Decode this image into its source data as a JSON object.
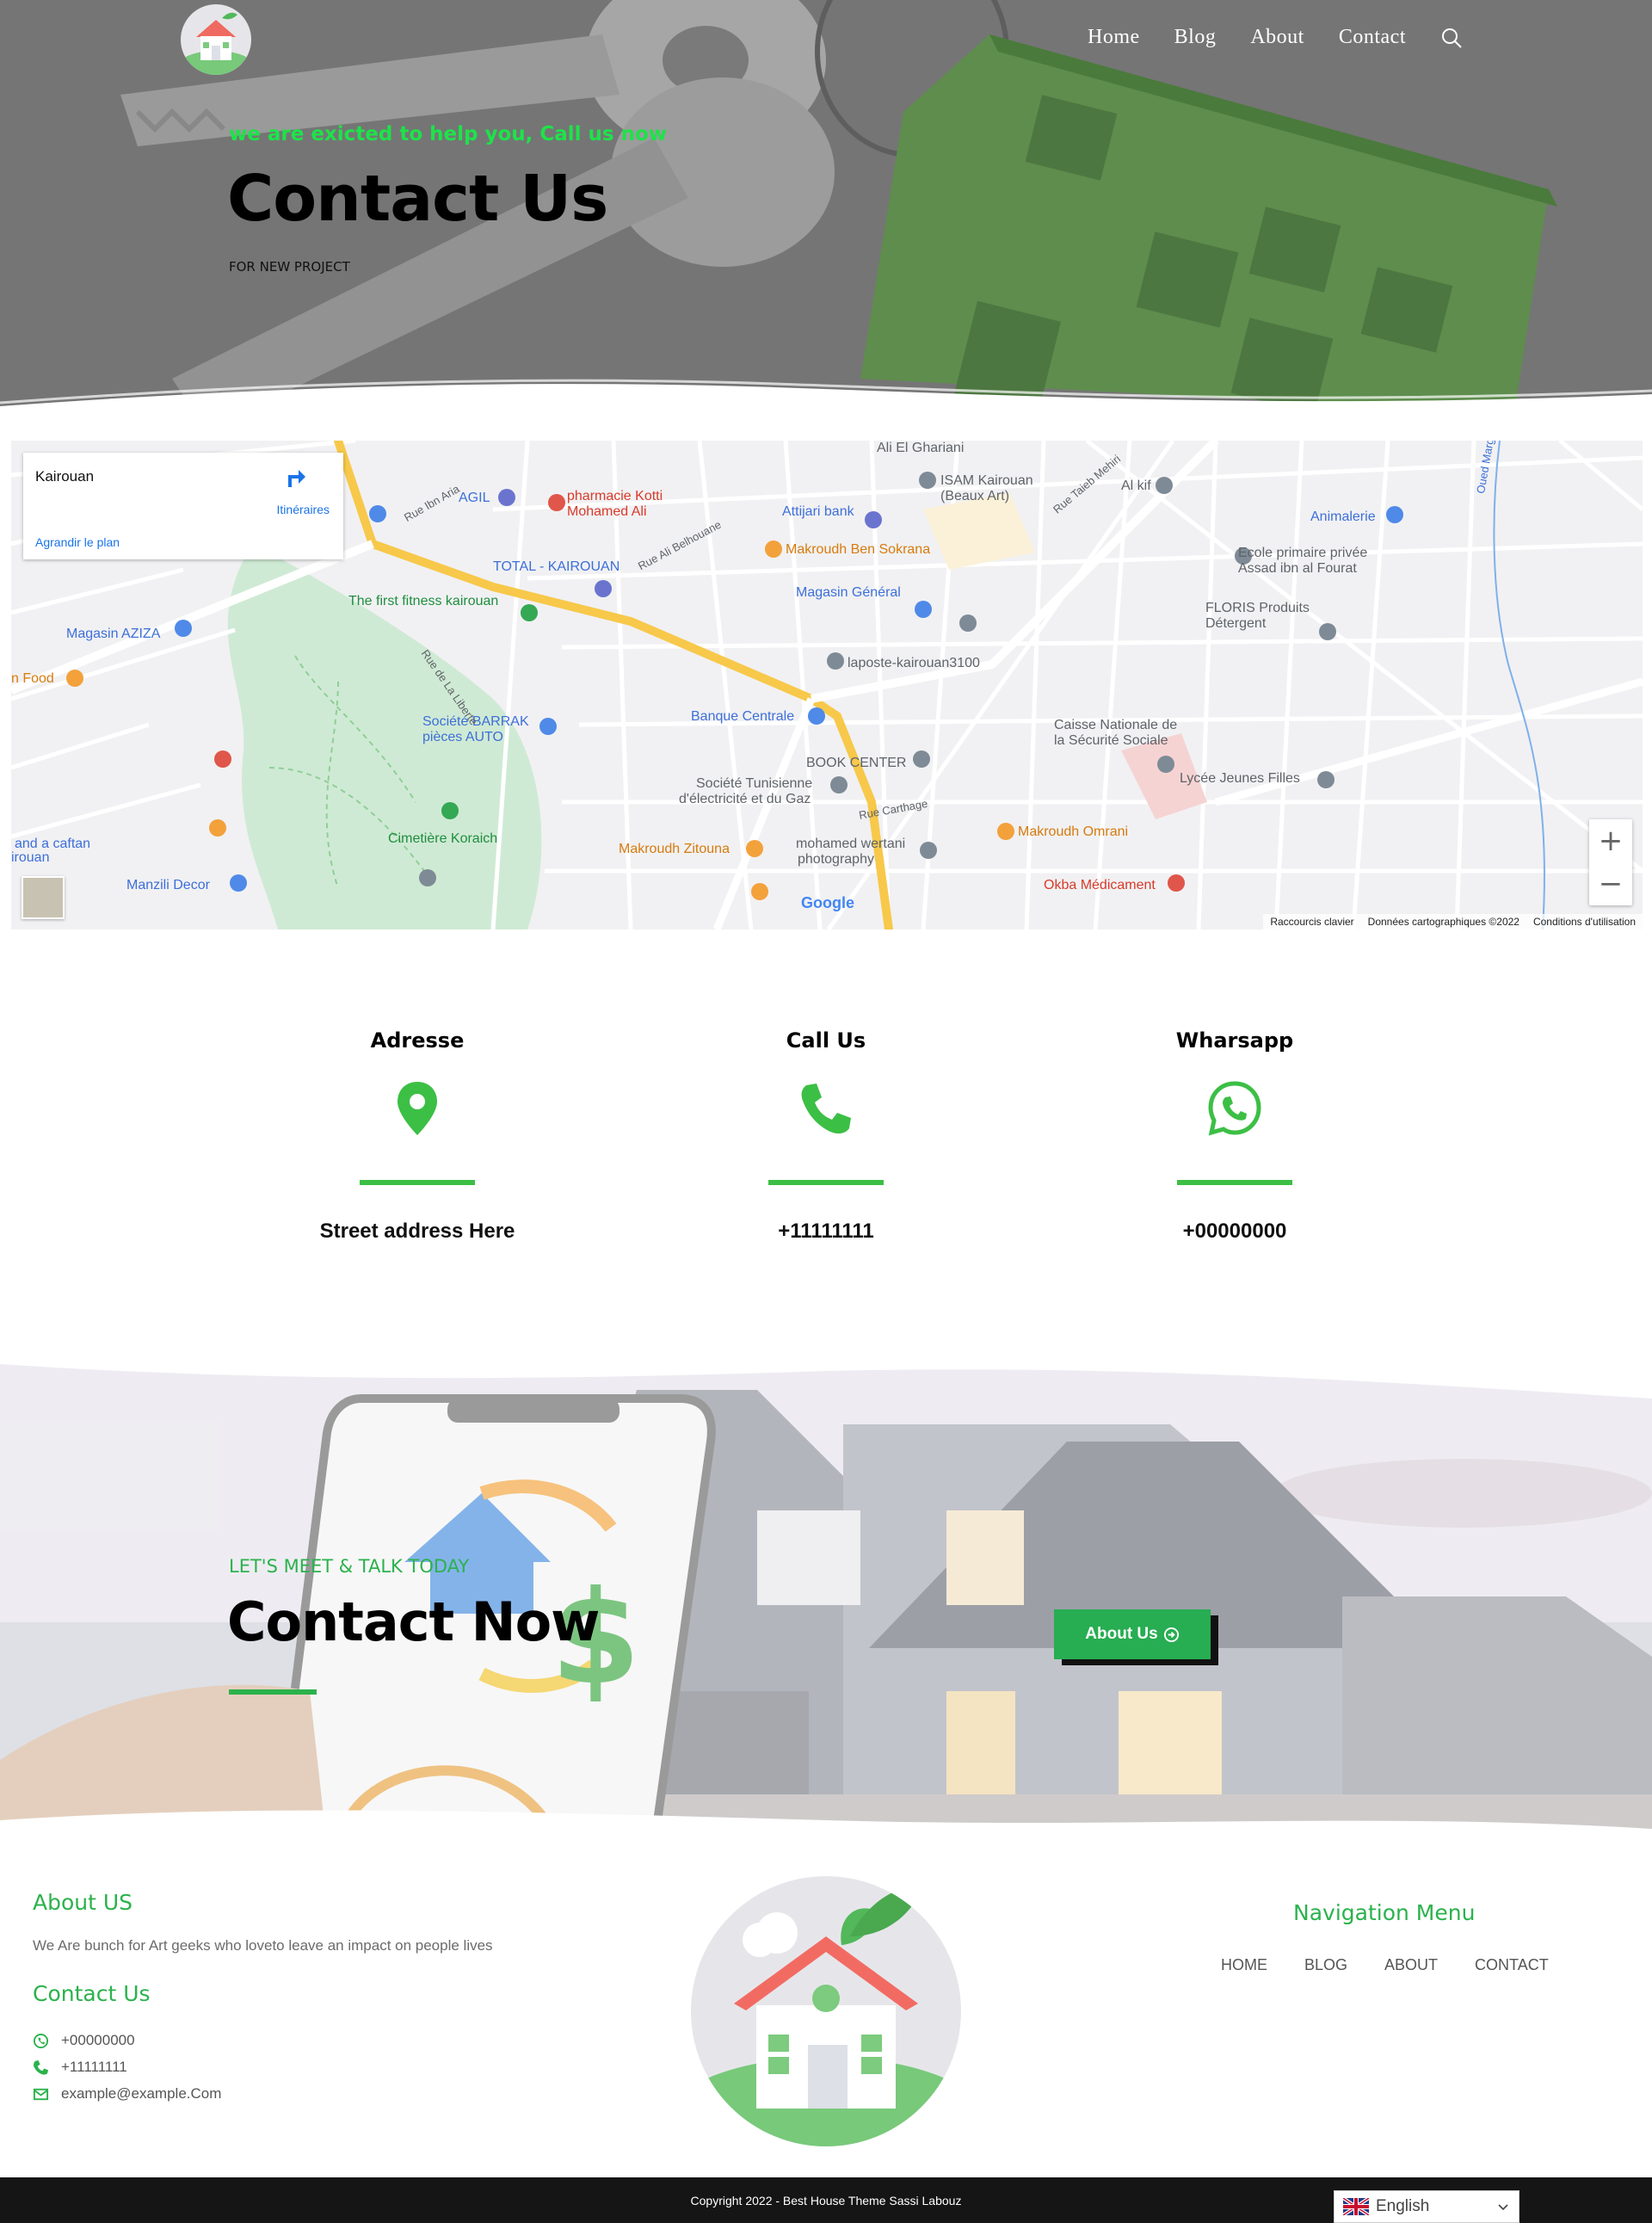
{
  "nav": {
    "items": [
      {
        "label": "Home"
      },
      {
        "label": "Blog"
      },
      {
        "label": "About"
      },
      {
        "label": "Contact"
      }
    ],
    "search_icon": "search-icon"
  },
  "hero": {
    "kicker": "we are exicted to help you, Call us now",
    "title": "Contact Us",
    "subtitle": "FOR NEW PROJECT"
  },
  "map": {
    "place_name": "Kairouan",
    "directions_label": "Itinéraires",
    "enlarge_label": "Agrandir le plan",
    "labels": [
      {
        "text": "Ali El Ghariani",
        "cls": "lbl-grey"
      },
      {
        "text": "ISAM Kairouan",
        "cls": "lbl-grey"
      },
      {
        "text": "(Beaux Art)",
        "cls": "lbl-grey"
      },
      {
        "text": "Al kif",
        "cls": "lbl-grey"
      },
      {
        "text": "AGIL",
        "cls": "lbl-blue"
      },
      {
        "text": "pharmacie Kotti",
        "cls": "lbl-red"
      },
      {
        "text": "Mohamed Ali",
        "cls": "lbl-red"
      },
      {
        "text": "Attijari bank",
        "cls": "lbl-blue"
      },
      {
        "text": "Makroudh Ben Sokrana",
        "cls": "lbl-orange"
      },
      {
        "text": "Animalerie",
        "cls": "lbl-blue"
      },
      {
        "text": "Ecole primaire privée",
        "cls": "lbl-grey"
      },
      {
        "text": "Assad ibn al Fourat",
        "cls": "lbl-grey"
      },
      {
        "text": "TOTAL - KAIROUAN",
        "cls": "lbl-blue"
      },
      {
        "text": "The first fitness kairouan",
        "cls": "lbl-green"
      },
      {
        "text": "Magasin Général",
        "cls": "lbl-blue"
      },
      {
        "text": "FLORIS Produits",
        "cls": "lbl-grey"
      },
      {
        "text": "Détergent",
        "cls": "lbl-grey"
      },
      {
        "text": "Magasin AZIZA",
        "cls": "lbl-blue"
      },
      {
        "text": "laposte-kairouan3100",
        "cls": "lbl-grey"
      },
      {
        "text": "n Food",
        "cls": "lbl-orange"
      },
      {
        "text": "Banque Centrale",
        "cls": "lbl-blue"
      },
      {
        "text": "Société BARRAK",
        "cls": "lbl-blue"
      },
      {
        "text": "pièces AUTO",
        "cls": "lbl-blue"
      },
      {
        "text": "Caisse Nationale de",
        "cls": "lbl-grey"
      },
      {
        "text": "la Sécurité Sociale",
        "cls": "lbl-grey"
      },
      {
        "text": "BOOK CENTER",
        "cls": "lbl-grey"
      },
      {
        "text": "Lycée Jeunes Filles",
        "cls": "lbl-grey"
      },
      {
        "text": "Société Tunisienne",
        "cls": "lbl-grey"
      },
      {
        "text": "d'électricité et du Gaz",
        "cls": "lbl-grey"
      },
      {
        "text": "Cimetière Koraich",
        "cls": "lbl-green"
      },
      {
        "text": "and a caftan",
        "cls": "lbl-blue"
      },
      {
        "text": "irouan",
        "cls": "lbl-blue"
      },
      {
        "text": "Makroudh Zitouna",
        "cls": "lbl-orange"
      },
      {
        "text": "mohamed wertani",
        "cls": "lbl-grey"
      },
      {
        "text": "photography",
        "cls": "lbl-grey"
      },
      {
        "text": "Makroudh Omrani",
        "cls": "lbl-orange"
      },
      {
        "text": "Manzili Decor",
        "cls": "lbl-blue"
      },
      {
        "text": "Okba Médicament",
        "cls": "lbl-red"
      },
      {
        "text": "Rue Ibn Aria",
        "cls": "lbl-grey"
      },
      {
        "text": "Rue Ali Belhouane",
        "cls": "lbl-grey"
      },
      {
        "text": "Rue de La Liberte",
        "cls": "lbl-grey"
      },
      {
        "text": "Rue Carthage",
        "cls": "lbl-grey"
      },
      {
        "text": "Rue Taieb Mehiri",
        "cls": "lbl-grey"
      },
      {
        "text": "Oued Marguellil",
        "cls": "lbl-blue"
      }
    ],
    "footer_links": [
      "Raccourcis clavier",
      "Données cartographiques ©2022",
      "Conditions d'utilisation"
    ],
    "google_logo": "Google",
    "zoom_in": "+",
    "zoom_out": "−"
  },
  "contact_info": [
    {
      "heading": "Adresse",
      "value": "Street address Here",
      "icon": "map-pin-icon"
    },
    {
      "heading": "Call Us",
      "value": "+11111111",
      "icon": "phone-icon"
    },
    {
      "heading": "Wharsapp",
      "value": "+00000000",
      "icon": "whatsapp-icon"
    }
  ],
  "cta": {
    "kicker": "LET'S MEET & TALK TODAY",
    "title": "Contact Now",
    "button_label": "About Us"
  },
  "footer": {
    "about_heading": "About US",
    "about_text": "We Are bunch for Art geeks who loveto leave an impact on people lives",
    "contact_heading": "Contact Us",
    "whatsapp": "+00000000",
    "phone": "+11111111",
    "email": "example@example.Com",
    "nav_heading": "Navigation Menu",
    "nav_items": [
      "HOME",
      "BLOG",
      "ABOUT",
      "CONTACT"
    ],
    "copyright": "Copyright 2022 - Best House Theme Sassi Labouz",
    "language": "English"
  },
  "colors": {
    "accent": "#2bb24c",
    "hero_kicker": "#1ee24a",
    "button": "#27ad52",
    "footer_bar": "#151515"
  }
}
